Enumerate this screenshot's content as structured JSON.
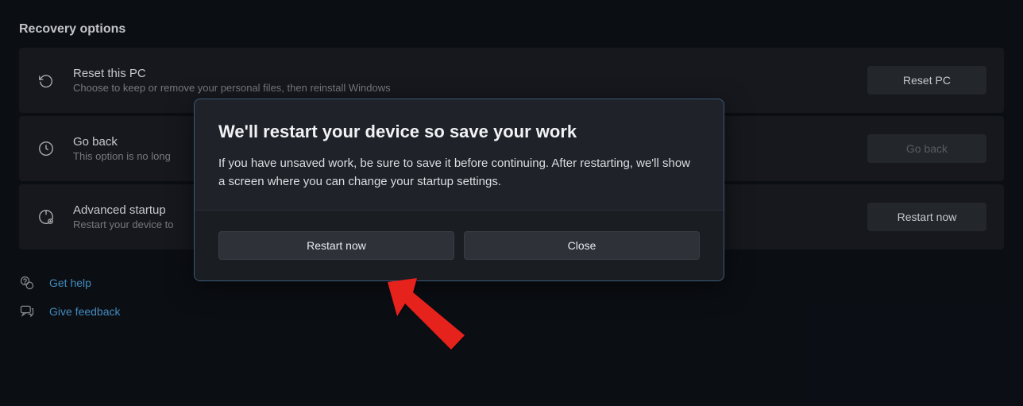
{
  "section_title": "Recovery options",
  "options": [
    {
      "title": "Reset this PC",
      "desc": "Choose to keep or remove your personal files, then reinstall Windows",
      "button": "Reset PC"
    },
    {
      "title": "Go back",
      "desc": "This option is no long",
      "button": "Go back"
    },
    {
      "title": "Advanced startup",
      "desc": "Restart your device to",
      "button": "Restart now"
    }
  ],
  "help_links": {
    "get_help": "Get help",
    "give_feedback": "Give feedback"
  },
  "dialog": {
    "title": "We'll restart your device so save your work",
    "body": "If you have unsaved work, be sure to save it before continuing. After restarting, we'll show a screen where you can change your startup settings.",
    "restart": "Restart now",
    "close": "Close"
  }
}
